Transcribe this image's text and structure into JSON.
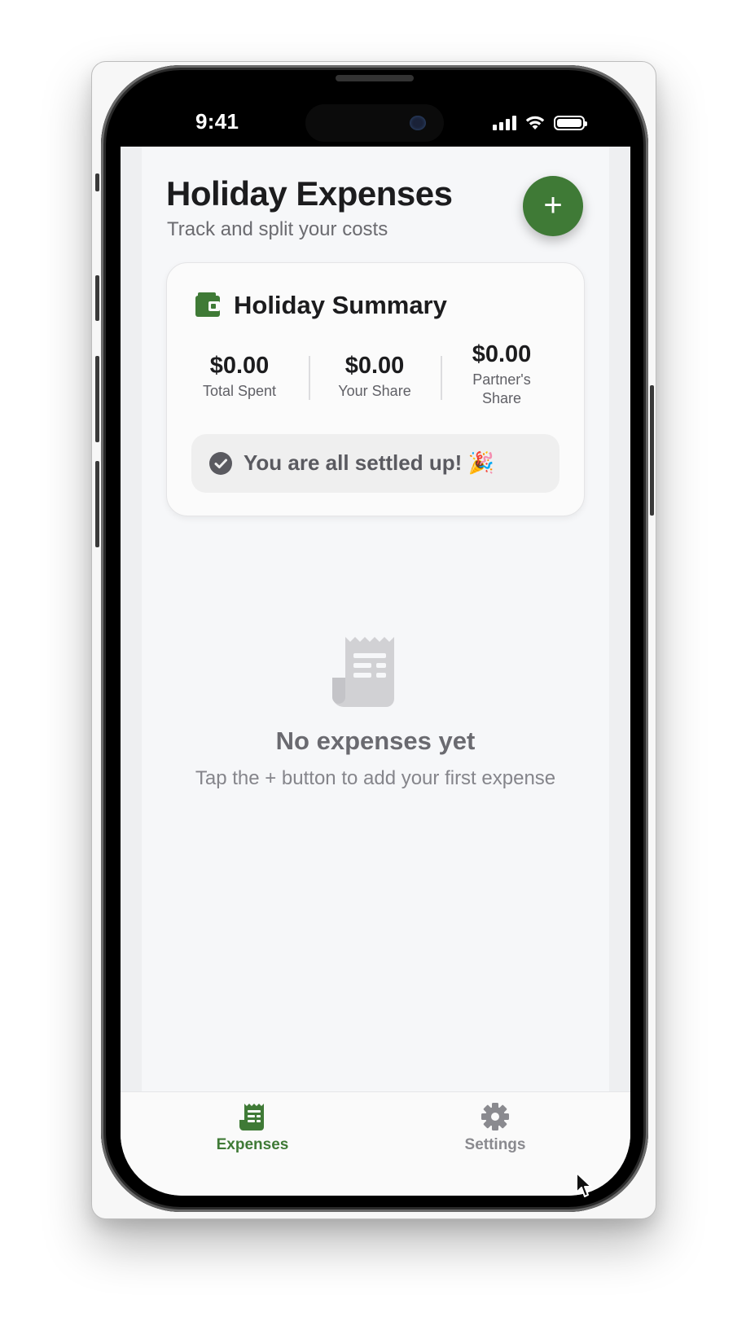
{
  "status_bar": {
    "time": "9:41"
  },
  "header": {
    "title": "Holiday Expenses",
    "subtitle": "Track and split your costs",
    "add_button_label": "+"
  },
  "summary": {
    "title": "Holiday Summary",
    "stats": [
      {
        "value": "$0.00",
        "label": "Total Spent"
      },
      {
        "value": "$0.00",
        "label": "Your Share"
      },
      {
        "value": "$0.00",
        "label": "Partner's Share"
      }
    ],
    "settled_message": "You are all settled up! 🎉"
  },
  "empty_state": {
    "title": "No expenses yet",
    "message": "Tap the + button to add your first expense"
  },
  "tab_bar": {
    "tabs": [
      {
        "label": "Expenses",
        "icon": "receipt-icon",
        "active": true
      },
      {
        "label": "Settings",
        "icon": "gear-icon",
        "active": false
      }
    ]
  },
  "colors": {
    "accent": "#3f7a36",
    "inactive_tab": "#8a8a8f",
    "background": "#f6f7f9"
  }
}
